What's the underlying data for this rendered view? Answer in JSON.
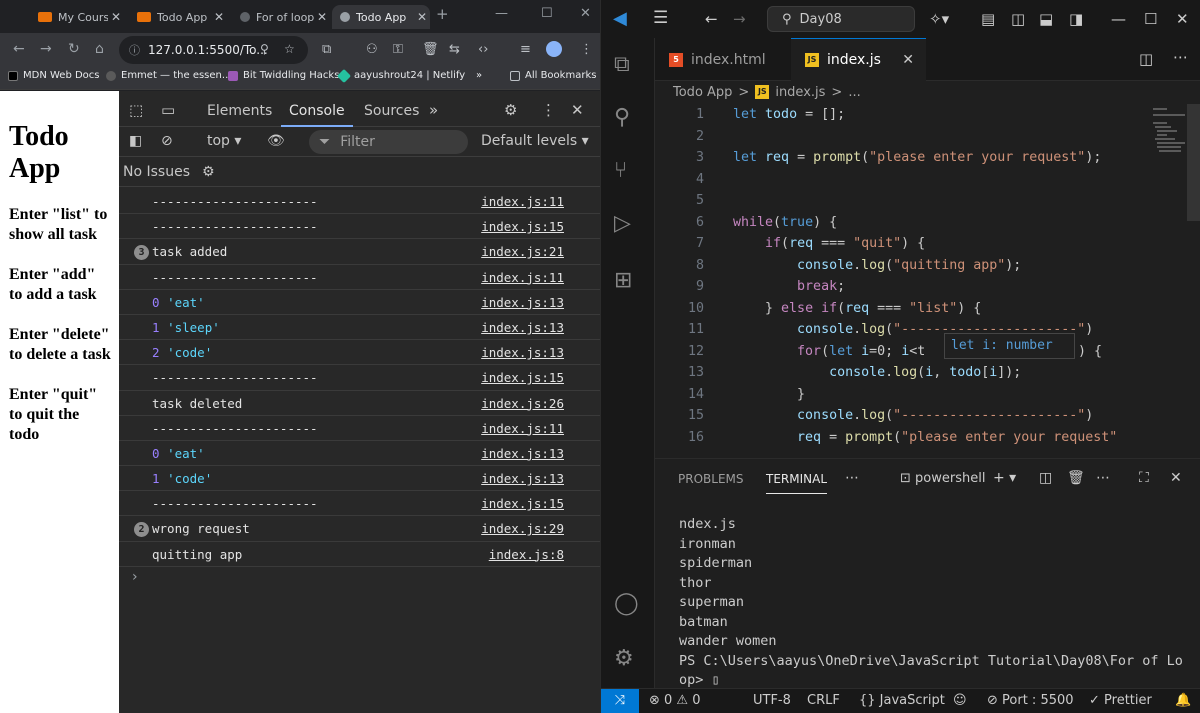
{
  "browser": {
    "tabs": [
      {
        "title": "My Course",
        "active": false
      },
      {
        "title": "Todo App",
        "active": false
      },
      {
        "title": "For of loop",
        "active": false
      },
      {
        "title": "Todo App",
        "active": true
      }
    ],
    "new_tab_icon": "plus-icon",
    "address": "127.0.0.1:5500/To...",
    "bookmarks": [
      "MDN Web Docs",
      "Emmet — the essen...",
      "Bit Twiddling Hacks",
      "aayushrout24 | Netlify",
      "»",
      "All Bookmarks"
    ]
  },
  "page": {
    "title": "Todo App",
    "instructions": [
      "Enter \"list\" to show all task",
      "Enter \"add\" to add a task",
      "Enter \"delete\" to delete a task",
      "Enter \"quit\" to quit the todo"
    ]
  },
  "devtools": {
    "tabs": [
      "Elements",
      "Console",
      "Sources"
    ],
    "active_tab": "Console",
    "context": "top",
    "filter_placeholder": "Filter",
    "levels": "Default levels",
    "issues": "No Issues",
    "logs": [
      {
        "msg": "----------------------",
        "src": "index.js:11"
      },
      {
        "msg": "----------------------",
        "src": "index.js:15"
      },
      {
        "count": "3",
        "msg": "task added",
        "src": "index.js:21"
      },
      {
        "msg": "----------------------",
        "src": "index.js:11"
      },
      {
        "num": "0",
        "str": "'eat'",
        "src": "index.js:13"
      },
      {
        "num": "1",
        "str": "'sleep'",
        "src": "index.js:13"
      },
      {
        "num": "2",
        "str": "'code'",
        "src": "index.js:13"
      },
      {
        "msg": "----------------------",
        "src": "index.js:15"
      },
      {
        "msg": "task deleted",
        "src": "index.js:26"
      },
      {
        "msg": "----------------------",
        "src": "index.js:11"
      },
      {
        "num": "0",
        "str": "'eat'",
        "src": "index.js:13"
      },
      {
        "num": "1",
        "str": "'code'",
        "src": "index.js:13"
      },
      {
        "msg": "----------------------",
        "src": "index.js:15"
      },
      {
        "count": "2",
        "msg": "wrong request",
        "src": "index.js:29"
      },
      {
        "msg": "quitting app",
        "src": "index.js:8"
      }
    ],
    "prompt": "›"
  },
  "vscode": {
    "search": "Day08",
    "editor_tabs": [
      {
        "name": "index.html",
        "active": false
      },
      {
        "name": "index.js",
        "active": true
      }
    ],
    "breadcrumb": [
      "Todo App",
      ">",
      "index.js",
      ">",
      "..."
    ],
    "code_lines": [
      {
        "n": "1",
        "html": "<span class='kw'>let</span> <span class='vr'>todo</span> = [];"
      },
      {
        "n": "2",
        "html": ""
      },
      {
        "n": "3",
        "html": "<span class='kw'>let</span> <span class='vr'>req</span> = <span class='fn'>prompt</span>(<span class='st'>\"please enter your request\"</span>);"
      },
      {
        "n": "4",
        "html": ""
      },
      {
        "n": "5",
        "html": ""
      },
      {
        "n": "6",
        "html": "<span class='kw2'>while</span>(<span class='kw'>true</span>) {"
      },
      {
        "n": "7",
        "html": "    <span class='kw2'>if</span>(<span class='vr'>req</span> === <span class='st'>\"quit\"</span>) {"
      },
      {
        "n": "8",
        "html": "        <span class='vr'>console</span>.<span class='fn'>log</span>(<span class='st'>\"quitting app\"</span>);"
      },
      {
        "n": "9",
        "html": "        <span class='kw2'>break</span>;"
      },
      {
        "n": "10",
        "html": "    } <span class='kw2'>else if</span>(<span class='vr'>req</span> === <span class='st'>\"list\"</span>) {"
      },
      {
        "n": "11",
        "html": "        <span class='vr'>console</span>.<span class='fn'>log</span>(<span class='st'>\"----------------------\"</span>)"
      },
      {
        "n": "12",
        "html": "        <span class='kw2'>for</span>(<span class='kw'>let</span> <span class='vr'>i</span>=0; <span class='vr'>i</span>&lt;t"
      },
      {
        "n": "13",
        "html": "            <span class='vr'>console</span>.<span class='fn'>log</span>(<span class='vr'>i</span>, <span class='vr'>todo</span>[<span class='vr'>i</span>]);"
      },
      {
        "n": "14",
        "html": "        }"
      },
      {
        "n": "15",
        "html": "        <span class='vr'>console</span>.<span class='fn'>log</span>(<span class='st'>\"----------------------\"</span>)"
      },
      {
        "n": "16",
        "html": "        <span class='vr'>req</span> = <span class='fn'>prompt</span>(<span class='st'>\"please enter your request\"</span>"
      }
    ],
    "line12_tail": ") {",
    "hover": "let i: number",
    "panel_tabs": [
      "PROBLEMS",
      "TERMINAL"
    ],
    "shell": "powershell",
    "terminal_lines": [
      "ndex.js",
      "ironman",
      "spiderman",
      "thor",
      "superman",
      "batman",
      "wander women",
      "PS C:\\Users\\aayus\\OneDrive\\JavaScript Tutorial\\Day08\\For of Lo",
      "op> ▯"
    ],
    "status": {
      "problems": "⊗ 0 ⚠ 0",
      "encoding": "UTF-8",
      "eol": "CRLF",
      "language": "{} JavaScript",
      "port": "⊘ Port : 5500",
      "prettier": "✓ Prettier"
    }
  }
}
